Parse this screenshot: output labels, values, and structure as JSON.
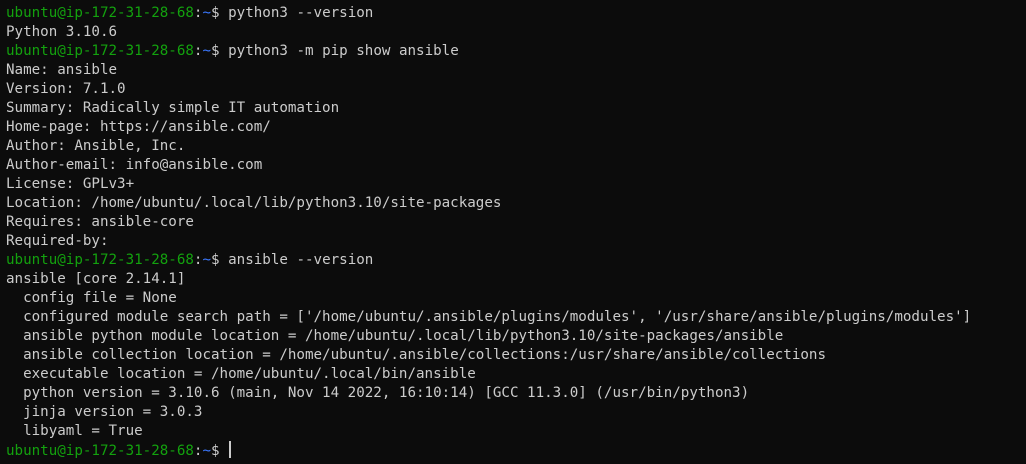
{
  "prompt": {
    "user_host": "ubuntu@ip-172-31-28-68",
    "colon": ":",
    "path": "~",
    "symbol": "$ "
  },
  "lines": [
    {
      "type": "prompt",
      "command": "python3 --version"
    },
    {
      "type": "output",
      "text": "Python 3.10.6"
    },
    {
      "type": "prompt",
      "command": "python3 -m pip show ansible"
    },
    {
      "type": "output",
      "text": "Name: ansible"
    },
    {
      "type": "output",
      "text": "Version: 7.1.0"
    },
    {
      "type": "output",
      "text": "Summary: Radically simple IT automation"
    },
    {
      "type": "output",
      "text": "Home-page: https://ansible.com/"
    },
    {
      "type": "output",
      "text": "Author: Ansible, Inc."
    },
    {
      "type": "output",
      "text": "Author-email: info@ansible.com"
    },
    {
      "type": "output",
      "text": "License: GPLv3+"
    },
    {
      "type": "output",
      "text": "Location: /home/ubuntu/.local/lib/python3.10/site-packages"
    },
    {
      "type": "output",
      "text": "Requires: ansible-core"
    },
    {
      "type": "output",
      "text": "Required-by:"
    },
    {
      "type": "prompt",
      "command": "ansible --version"
    },
    {
      "type": "output",
      "text": "ansible [core 2.14.1]"
    },
    {
      "type": "output",
      "text": "  config file = None"
    },
    {
      "type": "output",
      "text": "  configured module search path = ['/home/ubuntu/.ansible/plugins/modules', '/usr/share/ansible/plugins/modules']"
    },
    {
      "type": "output",
      "text": "  ansible python module location = /home/ubuntu/.local/lib/python3.10/site-packages/ansible"
    },
    {
      "type": "output",
      "text": "  ansible collection location = /home/ubuntu/.ansible/collections:/usr/share/ansible/collections"
    },
    {
      "type": "output",
      "text": "  executable location = /home/ubuntu/.local/bin/ansible"
    },
    {
      "type": "output",
      "text": "  python version = 3.10.6 (main, Nov 14 2022, 16:10:14) [GCC 11.3.0] (/usr/bin/python3)"
    },
    {
      "type": "output",
      "text": "  jinja version = 3.0.3"
    },
    {
      "type": "output",
      "text": "  libyaml = True"
    },
    {
      "type": "prompt",
      "command": "",
      "cursor": true
    }
  ],
  "colors": {
    "background": "#0c0c0c",
    "foreground": "#cccccc",
    "prompt_user": "#13a10e",
    "prompt_path": "#3b78ff"
  }
}
